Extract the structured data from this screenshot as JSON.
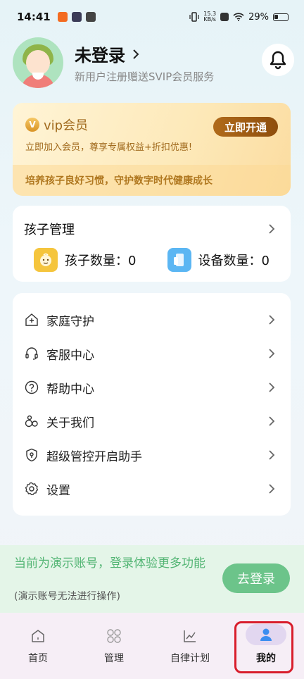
{
  "status": {
    "time": "14:41",
    "net_speed_value": "15.3",
    "net_speed_unit": "KB/s",
    "battery": "29%"
  },
  "profile": {
    "name": "未登录",
    "subtitle": "新用户注册赠送SVIP会员服务"
  },
  "vip": {
    "title": "vip会员",
    "badge": "V",
    "description": "立即加入会员，尊享专属权益+折扣优惠!",
    "button": "立即开通",
    "slogan": "培养孩子良好习惯，守护数字时代健康成长"
  },
  "kids": {
    "title": "孩子管理",
    "child_count_label": "孩子数量：0",
    "device_count_label": "设备数量：0"
  },
  "menu": [
    {
      "label": "家庭守护",
      "icon": "home-shield-icon"
    },
    {
      "label": "客服中心",
      "icon": "headset-icon"
    },
    {
      "label": "帮助中心",
      "icon": "help-circle-icon"
    },
    {
      "label": "关于我们",
      "icon": "people-icon"
    },
    {
      "label": "超级管控开启助手",
      "icon": "shield-icon"
    },
    {
      "label": "设置",
      "icon": "gear-icon"
    }
  ],
  "demo": {
    "message": "当前为演示账号，登录体验更多功能",
    "note": "(演示账号无法进行操作)",
    "login_button": "去登录"
  },
  "tabs": [
    {
      "label": "首页",
      "icon": "home-icon"
    },
    {
      "label": "管理",
      "icon": "grid-icon"
    },
    {
      "label": "自律计划",
      "icon": "chart-icon"
    },
    {
      "label": "我的",
      "icon": "person-icon",
      "active": true
    }
  ],
  "colors": {
    "accent_green": "#6cc48a",
    "vip_brown": "#a0691c",
    "highlight_red": "#d81e2c"
  }
}
